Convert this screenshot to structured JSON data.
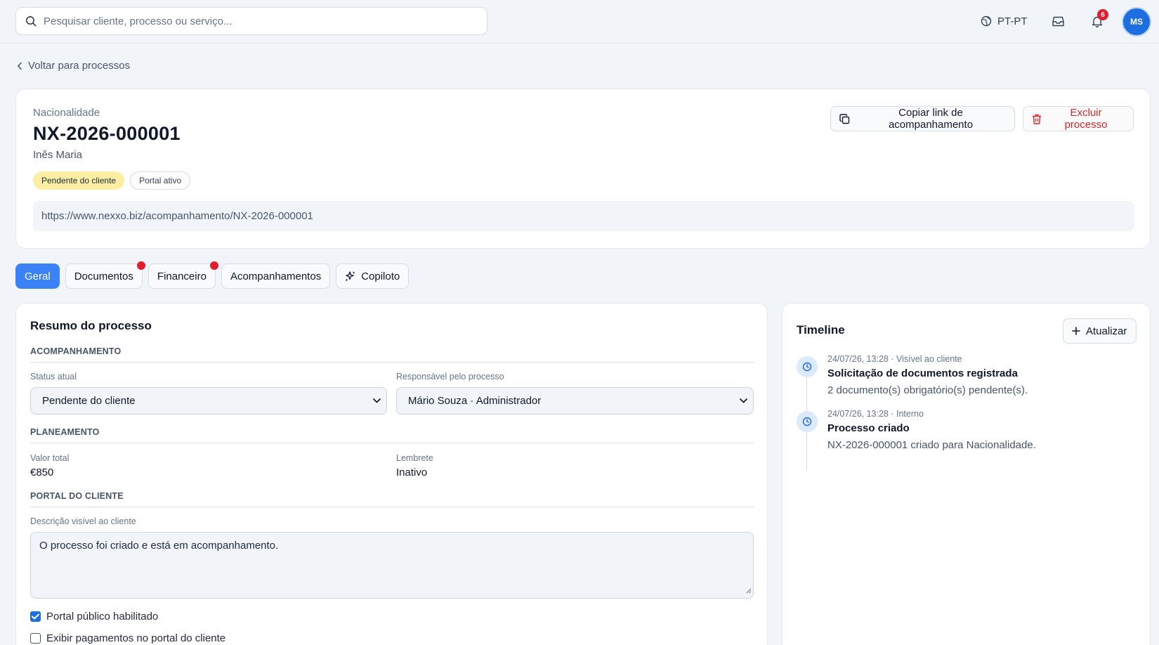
{
  "topbar": {
    "search_placeholder": "Pesquisar cliente, processo ou serviço...",
    "language": "PT-PT",
    "notifications_count": "6",
    "avatar_initials": "MS",
    "icons": [
      "search-icon",
      "globe-icon",
      "inbox-icon",
      "bell-icon"
    ]
  },
  "nav": {
    "back_label": "Voltar para processos"
  },
  "process": {
    "service": "Nacionalidade",
    "number": "NX-2026-000001",
    "client": "Inês Maria",
    "badges": {
      "status": "Pendente do cliente",
      "portal": "Portal ativo"
    },
    "tracking_url": "https://www.nexxo.biz/acompanhamento/NX-2026-000001",
    "actions": {
      "copy_link": "Copiar link de acompanhamento",
      "delete": "Excluir processo"
    }
  },
  "tabs": [
    {
      "label": "Geral",
      "active": true,
      "alert": false
    },
    {
      "label": "Documentos",
      "active": false,
      "alert": true
    },
    {
      "label": "Financeiro",
      "active": false,
      "alert": true
    },
    {
      "label": "Acompanhamentos",
      "active": false,
      "alert": false
    },
    {
      "label": "Copiloto",
      "active": false,
      "alert": false
    }
  ],
  "summary": {
    "title": "Resumo do processo",
    "sections": {
      "tracking": "ACOMPANHAMENTO",
      "planning": "PLANEAMENTO",
      "portal": "PORTAL DO CLIENTE"
    },
    "status": {
      "label": "Status atual",
      "value": "Pendente do cliente"
    },
    "owner": {
      "label": "Responsável pelo processo",
      "value": "Mário Souza · Administrador"
    },
    "total": {
      "label": "Valor total",
      "value": "€850"
    },
    "reminder": {
      "label": "Lembrete",
      "value": "Inativo"
    },
    "description": {
      "label": "Descrição visível ao cliente",
      "value": "O processo foi criado e está em acompanhamento."
    },
    "checkboxes": {
      "public_portal": {
        "label": "Portal público habilitado",
        "checked": true
      },
      "show_payments": {
        "label": "Exibir pagamentos no portal do cliente",
        "checked": false
      }
    }
  },
  "timeline": {
    "title": "Timeline",
    "refresh_label": "Atualizar",
    "events": [
      {
        "meta": "24/07/26, 13:28 · Visível ao cliente",
        "title": "Solicitação de documentos registrada",
        "description": "2 documento(s) obrigatório(s) pendente(s)."
      },
      {
        "meta": "24/07/26, 13:28 · Interno",
        "title": "Processo criado",
        "description": "NX-2026-000001 criado para Nacionalidade."
      }
    ]
  },
  "colors": {
    "accent": "#3b82f6",
    "danger": "#dc2626",
    "alert_dot": "#e11d2e",
    "pending_badge": "#fcefa4"
  }
}
